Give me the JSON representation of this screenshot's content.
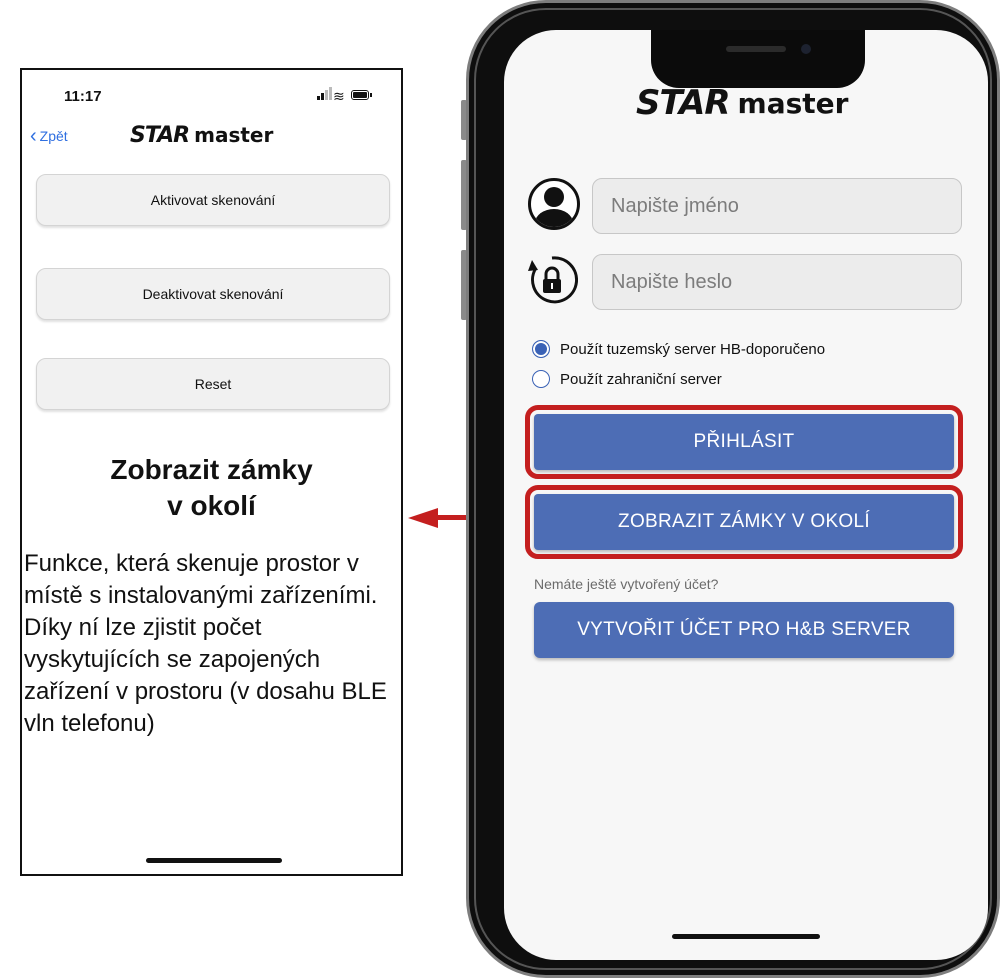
{
  "left_screen": {
    "status_time": "11:17",
    "back_label": "Zpět",
    "logo_star": "STAR",
    "logo_master": "master",
    "buttons": [
      {
        "label": "Aktivovat skenování"
      },
      {
        "label": "Deaktivovat skenování"
      },
      {
        "label": "Reset"
      }
    ],
    "title_line1": "Zobrazit zámky",
    "title_line2": "v okolí",
    "description": "Funkce, která skenuje prostor v místě s instalovanými zařízeními. Díky ní lze zjistit počet vyskytujících se zapojených zařízení v prostoru (v dosahu BLE vln telefonu)"
  },
  "phone_screen": {
    "logo_star": "STAR",
    "logo_master": "master",
    "name_placeholder": "Napište jméno",
    "password_placeholder": "Napište heslo",
    "radio_options": [
      {
        "label": "Použít tuzemský server HB-doporučeno",
        "selected": true
      },
      {
        "label": "Použít zahraniční server",
        "selected": false
      }
    ],
    "login_button": "PŘIHLÁSIT",
    "show_locks_button": "ZOBRAZIT ZÁMKY V OKOLÍ",
    "no_account_hint": "Nemáte ještě vytvořený účet?",
    "create_account_button": "VYTVOŘIT ÚČET PRO H&B SERVER"
  },
  "colors": {
    "accent_blue": "#4d6db5",
    "highlight_red": "#c41f1f",
    "link_blue": "#2f6fe0"
  },
  "icons": [
    "back-chevron-icon",
    "signal-icon",
    "wifi-icon",
    "battery-icon",
    "user-avatar-icon",
    "lock-refresh-icon",
    "arrow-left-icon",
    "arrow-right-icon"
  ]
}
